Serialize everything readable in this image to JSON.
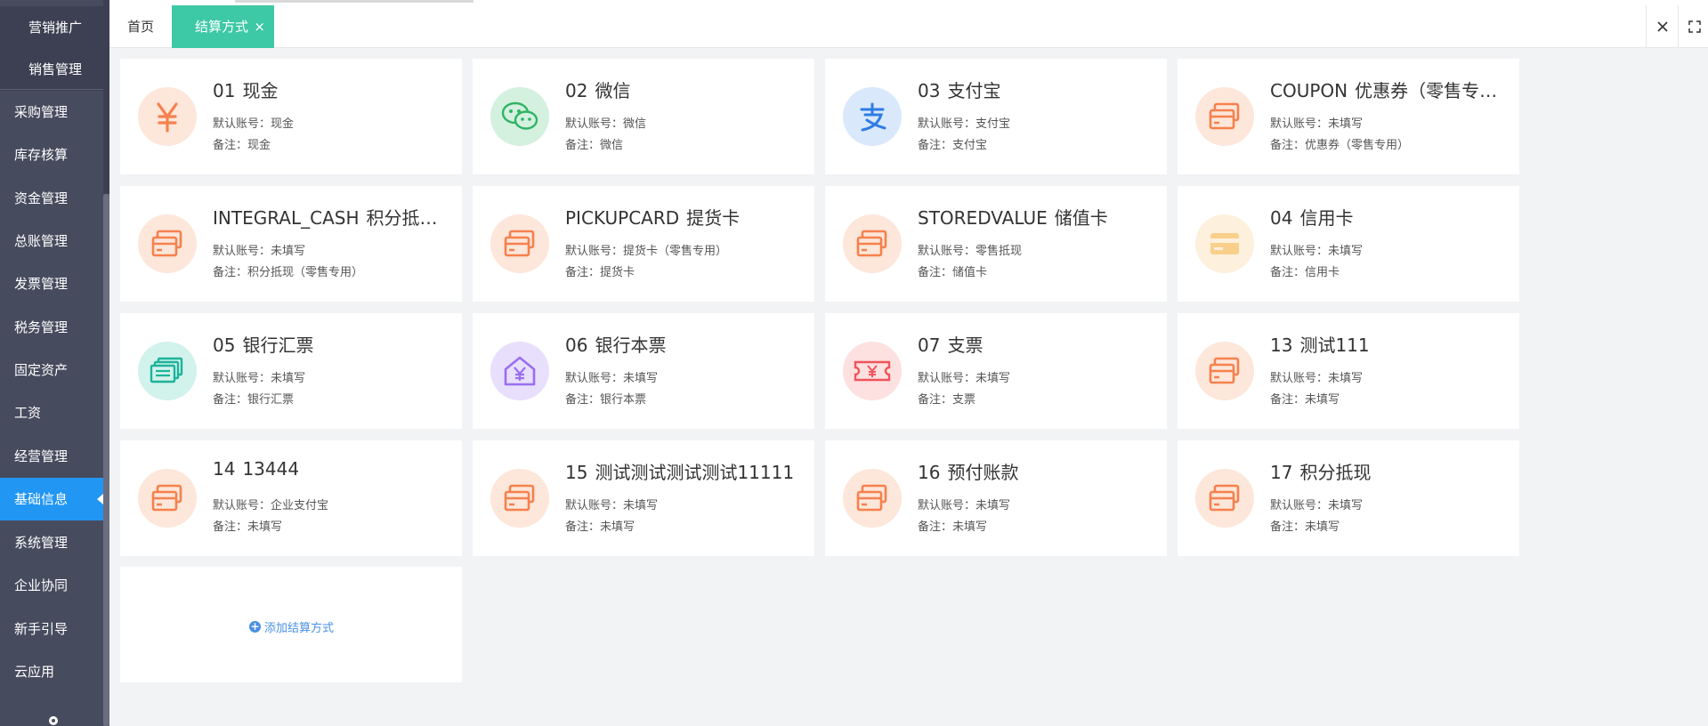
{
  "sidebar": {
    "items": [
      {
        "label": "营销推广"
      },
      {
        "label": "销售管理"
      },
      {
        "label": "采购管理"
      },
      {
        "label": "库存核算"
      },
      {
        "label": "资金管理"
      },
      {
        "label": "总账管理"
      },
      {
        "label": "发票管理"
      },
      {
        "label": "税务管理"
      },
      {
        "label": "固定资产"
      },
      {
        "label": "工资"
      },
      {
        "label": "经营管理"
      },
      {
        "label": "基础信息"
      },
      {
        "label": "系统管理"
      },
      {
        "label": "企业协同"
      },
      {
        "label": "新手引导"
      },
      {
        "label": "云应用"
      }
    ],
    "active_item": "基础信息"
  },
  "tabs": [
    {
      "label": "首页"
    },
    {
      "label": "结算方式",
      "close": "×"
    }
  ],
  "cards": [
    {
      "code": "01",
      "name": "现金",
      "account_label": "默认账号：",
      "account": "现金",
      "note_label": "备注：",
      "note": "现金",
      "icon": "yen-icon"
    },
    {
      "code": "02",
      "name": "微信",
      "account_label": "默认账号：",
      "account": "微信",
      "note_label": "备注：",
      "note": "微信",
      "icon": "wechat-icon"
    },
    {
      "code": "03",
      "name": "支付宝",
      "account_label": "默认账号：",
      "account": "支付宝",
      "note_label": "备注：",
      "note": "支付宝",
      "icon": "alipay-icon"
    },
    {
      "code": "COUPON",
      "name": "优惠券（零售专用）",
      "account_label": "默认账号：",
      "account": "未填写",
      "note_label": "备注：",
      "note": "优惠券（零售专用）",
      "icon": "card-icon"
    },
    {
      "code": "INTEGRAL_CASH",
      "name": "积分抵现（零售专用）",
      "account_label": "默认账号：",
      "account": "未填写",
      "note_label": "备注：",
      "note": "积分抵现（零售专用）",
      "icon": "card-icon"
    },
    {
      "code": "PICKUPCARD",
      "name": "提货卡",
      "account_label": "默认账号：",
      "account": "提货卡（零售专用）",
      "note_label": "备注：",
      "note": "提货卡",
      "icon": "card-icon"
    },
    {
      "code": "STOREDVALUE",
      "name": "储值卡",
      "account_label": "默认账号：",
      "account": "零售抵现",
      "note_label": "备注：",
      "note": "储值卡",
      "icon": "card-icon"
    },
    {
      "code": "04",
      "name": "信用卡",
      "account_label": "默认账号：",
      "account": "未填写",
      "note_label": "备注：",
      "note": "信用卡",
      "icon": "credit-card-icon"
    },
    {
      "code": "05",
      "name": "银行汇票",
      "account_label": "默认账号：",
      "account": "未填写",
      "note_label": "备注：",
      "note": "银行汇票",
      "icon": "bank-draft-icon"
    },
    {
      "code": "06",
      "name": "银行本票",
      "account_label": "默认账号：",
      "account": "未填写",
      "note_label": "备注：",
      "note": "银行本票",
      "icon": "bank-house-icon"
    },
    {
      "code": "07",
      "name": "支票",
      "account_label": "默认账号：",
      "account": "未填写",
      "note_label": "备注：",
      "note": "支票",
      "icon": "ticket-icon"
    },
    {
      "code": "13",
      "name": "测试111",
      "account_label": "默认账号：",
      "account": "未填写",
      "note_label": "备注：",
      "note": "未填写",
      "icon": "card-icon"
    },
    {
      "code": "14",
      "name": "13444",
      "account_label": "默认账号：",
      "account": "企业支付宝",
      "note_label": "备注：",
      "note": "未填写",
      "icon": "card-icon"
    },
    {
      "code": "15",
      "name": "测试测试测试测试11111",
      "account_label": "默认账号：",
      "account": "未填写",
      "note_label": "备注：",
      "note": "未填写",
      "icon": "card-icon"
    },
    {
      "code": "16",
      "name": "预付账款",
      "account_label": "默认账号：",
      "account": "未填写",
      "note_label": "备注：",
      "note": "未填写",
      "icon": "card-icon"
    },
    {
      "code": "17",
      "name": "积分抵现",
      "account_label": "默认账号：",
      "account": "未填写",
      "note_label": "备注：",
      "note": "未填写",
      "icon": "card-icon"
    }
  ],
  "add_button": {
    "icon": "+",
    "label": "添加结算方式"
  },
  "colors": {
    "sidebar_bg": "#474b5e",
    "active_blue": "#2196f3",
    "tab_active": "#3dc8a6",
    "orange": "#f5814d",
    "link_blue": "#4a90e2"
  }
}
